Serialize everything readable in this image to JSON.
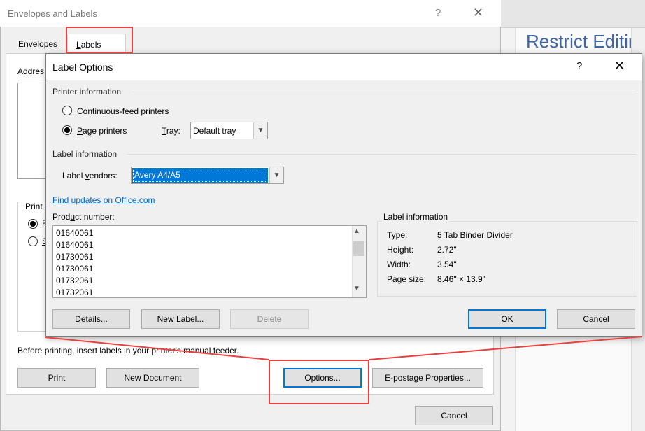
{
  "background": {
    "restrict_text": "Restrict Editing"
  },
  "envelopes_dialog": {
    "title": "Envelopes and Labels",
    "help": "?",
    "close": "✕",
    "tabs": [
      {
        "label": "Envelopes"
      },
      {
        "label": "Labels",
        "active": true
      }
    ],
    "address_label": "Addres",
    "print_group_label": "Print",
    "radio_fragments": [
      "F",
      "S"
    ],
    "note": "Before printing, insert labels in your printer's manual feeder.",
    "buttons": {
      "print": "Print",
      "new_document": "New Document",
      "options": "Options...",
      "epostage": "E-postage Properties...",
      "cancel": "Cancel"
    }
  },
  "label_options": {
    "title": "Label Options",
    "help": "?",
    "close": "✕",
    "printer_information": {
      "title": "Printer information",
      "continuous_feed": "Continuous-feed printers",
      "page_printers": "Page printers",
      "selected": "page_printers",
      "tray_label": "Tray:",
      "tray_value": "Default tray"
    },
    "label_information_section": {
      "title": "Label information",
      "vendor_label": "Label vendors:",
      "vendor_value": "Avery A4/A5"
    },
    "find_updates_link": "Find updates on Office.com",
    "product_number": {
      "label": "Product number:",
      "items": [
        "01640061",
        "01640061",
        "01730061",
        "01730061",
        "01732061",
        "01732061"
      ]
    },
    "label_information": {
      "title": "Label information",
      "rows": [
        {
          "key": "Type:",
          "value": "5 Tab Binder Divider"
        },
        {
          "key": "Height:",
          "value": "2.72\""
        },
        {
          "key": "Width:",
          "value": "3.54\""
        },
        {
          "key": "Page size:",
          "value": "8.46\" × 13.9\""
        }
      ]
    },
    "buttons": {
      "details": "Details...",
      "new_label": "New Label...",
      "delete": "Delete",
      "ok": "OK",
      "cancel": "Cancel"
    }
  },
  "colors": {
    "highlight": "#e8413f",
    "accent": "#0078d7",
    "link": "#0066cc"
  }
}
